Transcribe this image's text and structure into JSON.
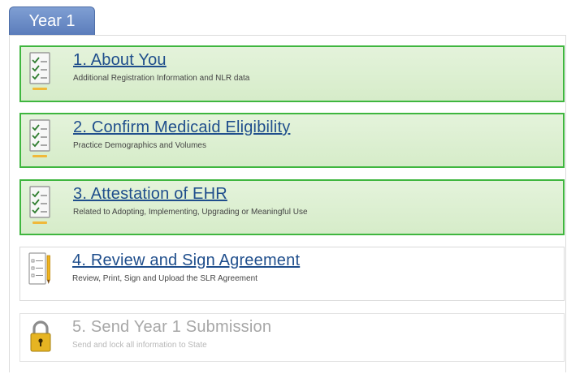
{
  "tab": {
    "label": "Year 1"
  },
  "steps": [
    {
      "title": "1. About You",
      "subtitle": "Additional Registration Information and NLR data",
      "status": "complete",
      "icon": "checklist-icon"
    },
    {
      "title": "2. Confirm Medicaid Eligibility",
      "subtitle": "Practice Demographics and Volumes",
      "status": "complete",
      "icon": "checklist-icon"
    },
    {
      "title": "3. Attestation of EHR",
      "subtitle": "Related to Adopting, Implementing, Upgrading or Meaningful Use",
      "status": "complete",
      "icon": "checklist-icon"
    },
    {
      "title": "4. Review and Sign Agreement",
      "subtitle": "Review, Print, Sign and Upload the SLR Agreement",
      "status": "current",
      "icon": "document-pencil-icon"
    },
    {
      "title": "5. Send Year 1 Submission",
      "subtitle": "Send and lock all information to State",
      "status": "locked",
      "icon": "lock-icon"
    }
  ],
  "colors": {
    "complete_border": "#3fb63f",
    "complete_fill": "#dbeed0",
    "link": "#1f4e8c",
    "tab": "#6a8cc7"
  }
}
